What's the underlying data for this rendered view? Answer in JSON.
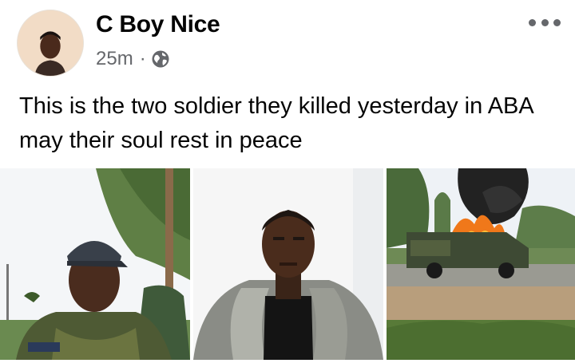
{
  "post": {
    "author_name": "C Boy Nice",
    "time": "25m",
    "separator": "·",
    "privacy_icon": "globe-icon",
    "more_icon": "more-options-icon",
    "text": "This is the two soldier they killed yesterday in ABA may their soul rest in peace"
  },
  "photos": [
    {
      "name": "soldier-in-cap-photo"
    },
    {
      "name": "young-man-portrait-photo"
    },
    {
      "name": "burning-military-vehicle-photo"
    }
  ],
  "colors": {
    "text_primary": "#050505",
    "text_secondary": "#65676b",
    "background": "#ffffff"
  }
}
